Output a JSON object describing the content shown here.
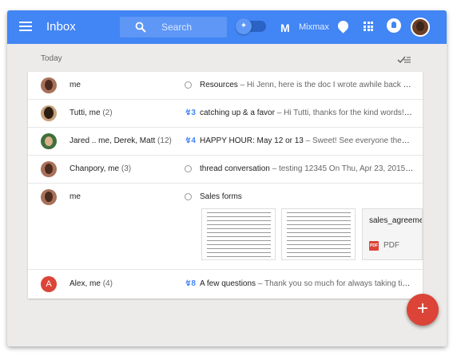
{
  "header": {
    "title": "Inbox",
    "search_placeholder": "Search",
    "mixmax_label": "Mixmax",
    "mixmax_logo": "M",
    "accent_color": "#4285f4"
  },
  "section": {
    "label": "Today"
  },
  "rows": [
    {
      "sender": "me",
      "count": "",
      "marker": "circle",
      "bolt": "",
      "subject": "Resources",
      "snippet": " – Hi Jenn, here is the doc I wrote awhile back on ..."
    },
    {
      "sender": "Tutti, me",
      "count": "(2)",
      "marker": "bolt",
      "bolt": "3",
      "subject": "catching up & a favor",
      "snippet": " – Hi Tutti, thanks for the kind words! S..."
    },
    {
      "sender": "Jared .. me, Derek, Matt",
      "count": "(12)",
      "marker": "bolt",
      "bolt": "4",
      "subject": "HAPPY HOUR: May 12 or 13",
      "snippet": " – Sweet! See everyone then, a..."
    },
    {
      "sender": "Chanpory, me",
      "count": "(3)",
      "marker": "circle",
      "bolt": "",
      "subject": "thread conversation",
      "snippet": " – testing 12345 On Thu, Apr 23, 2015 at ..."
    },
    {
      "sender": "me",
      "count": "",
      "marker": "circle",
      "bolt": "",
      "subject": "Sales forms",
      "snippet": ""
    },
    {
      "sender": "Alex, me",
      "count": "(4)",
      "marker": "bolt",
      "bolt": "8",
      "subject": "A few questions",
      "snippet": " – Thank you so much for always taking time..."
    }
  ],
  "attachment": {
    "file_name": "sales_agreement",
    "file_type": "PDF",
    "pdf_badge": "PDF"
  },
  "avatar_letter": "A",
  "fab_label": "+"
}
